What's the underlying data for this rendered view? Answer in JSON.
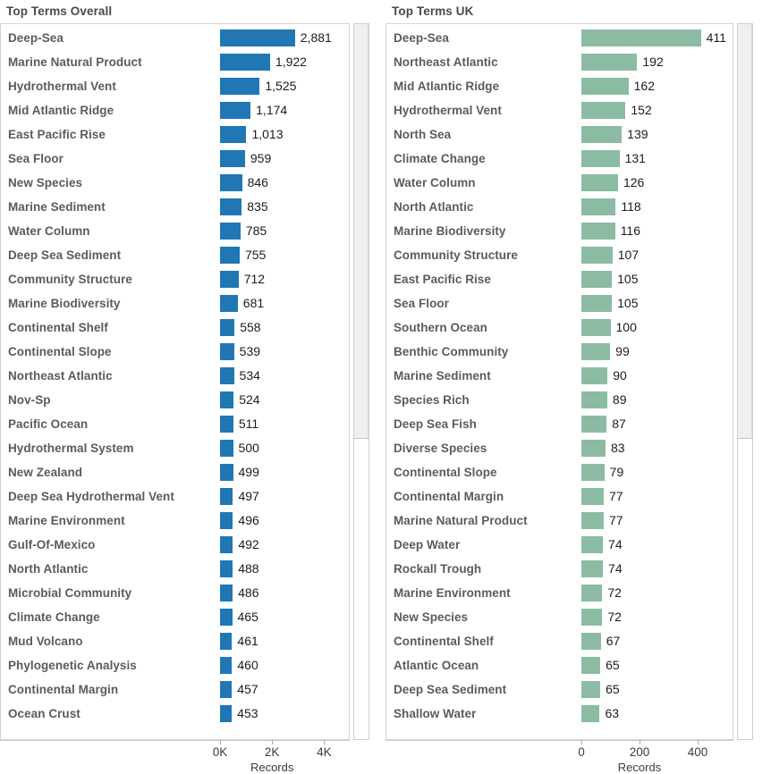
{
  "chart_data": [
    {
      "type": "bar",
      "title": "Top Terms Overall",
      "orientation": "horizontal",
      "xlabel": "Records",
      "ylabel": "",
      "color": "#2077b4",
      "xlim": [
        0,
        4950
      ],
      "ticks": [
        {
          "value": 0,
          "label": "0K"
        },
        {
          "value": 2000,
          "label": "2K"
        },
        {
          "value": 4000,
          "label": "4K"
        }
      ],
      "grid": false,
      "legend": "none",
      "categories": [
        "Deep-Sea",
        "Marine Natural Product",
        "Hydrothermal Vent",
        "Mid Atlantic Ridge",
        "East Pacific Rise",
        "Sea Floor",
        "New Species",
        "Marine Sediment",
        "Water Column",
        "Deep Sea Sediment",
        "Community Structure",
        "Marine Biodiversity",
        "Continental Shelf",
        "Continental Slope",
        "Northeast Atlantic",
        "Nov-Sp",
        "Pacific Ocean",
        "Hydrothermal System",
        "New Zealand",
        "Deep Sea Hydrothermal Vent",
        "Marine Environment",
        "Gulf-Of-Mexico",
        "North Atlantic",
        "Microbial Community",
        "Climate Change",
        "Mud Volcano",
        "Phylogenetic Analysis",
        "Continental Margin",
        "Ocean Crust"
      ],
      "values": [
        2881,
        1922,
        1525,
        1174,
        1013,
        959,
        846,
        835,
        785,
        755,
        712,
        681,
        558,
        539,
        534,
        524,
        511,
        500,
        499,
        497,
        496,
        492,
        488,
        486,
        465,
        461,
        460,
        457,
        453
      ],
      "value_labels": [
        "2,881",
        "1,922",
        "1,525",
        "1,174",
        "1,013",
        "959",
        "846",
        "835",
        "785",
        "755",
        "712",
        "681",
        "558",
        "539",
        "534",
        "524",
        "511",
        "500",
        "499",
        "497",
        "496",
        "492",
        "488",
        "486",
        "465",
        "461",
        "460",
        "457",
        "453"
      ]
    },
    {
      "type": "bar",
      "title": "Top Terms UK",
      "orientation": "horizontal",
      "xlabel": "Records",
      "ylabel": "",
      "color": "#8cbba4",
      "xlim": [
        0,
        520
      ],
      "ticks": [
        {
          "value": 0,
          "label": "0"
        },
        {
          "value": 200,
          "label": "200"
        },
        {
          "value": 400,
          "label": "400"
        }
      ],
      "grid": false,
      "legend": "none",
      "categories": [
        "Deep-Sea",
        "Northeast Atlantic",
        "Mid Atlantic Ridge",
        "Hydrothermal Vent",
        "North Sea",
        "Climate Change",
        "Water Column",
        "North Atlantic",
        "Marine Biodiversity",
        "Community Structure",
        "East Pacific Rise",
        "Sea Floor",
        "Southern Ocean",
        "Benthic Community",
        "Marine Sediment",
        "Species Rich",
        "Deep Sea Fish",
        "Diverse Species",
        "Continental Slope",
        "Continental Margin",
        "Marine Natural Product",
        "Deep Water",
        "Rockall Trough",
        "Marine Environment",
        "New Species",
        "Continental Shelf",
        "Atlantic Ocean",
        "Deep Sea Sediment",
        "Shallow Water"
      ],
      "values": [
        411,
        192,
        162,
        152,
        139,
        131,
        126,
        118,
        116,
        107,
        105,
        105,
        100,
        99,
        90,
        89,
        87,
        83,
        79,
        77,
        77,
        74,
        74,
        72,
        72,
        67,
        65,
        65,
        63
      ],
      "value_labels": [
        "411",
        "192",
        "162",
        "152",
        "139",
        "131",
        "126",
        "118",
        "116",
        "107",
        "105",
        "105",
        "100",
        "99",
        "90",
        "89",
        "87",
        "83",
        "79",
        "77",
        "77",
        "74",
        "74",
        "72",
        "72",
        "67",
        "65",
        "65",
        "63"
      ]
    }
  ],
  "panels": [
    {
      "id": "overall",
      "title": "Top Terms Overall",
      "axis_title": "Records",
      "scrollbar": {
        "thumb_top_pct": 0,
        "thumb_height_pct": 58
      }
    },
    {
      "id": "uk",
      "title": "Top Terms UK",
      "axis_title": "Records",
      "scrollbar": {
        "thumb_top_pct": 0,
        "thumb_height_pct": 58
      }
    }
  ]
}
